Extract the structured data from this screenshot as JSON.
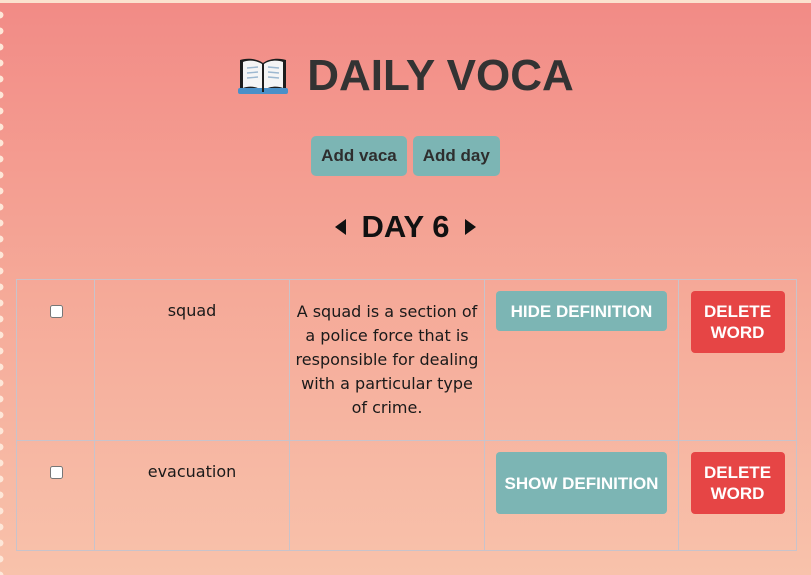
{
  "app": {
    "title": "DAILY VOCA"
  },
  "toolbar": {
    "add_voca_label": "Add vaca",
    "add_day_label": "Add day"
  },
  "day_nav": {
    "title": "DAY 6"
  },
  "words": [
    {
      "checked": false,
      "word": "squad",
      "definition": "A squad is a section of a police force that is responsible for dealing with a particular type of crime.",
      "toggle_label": "HIDE DEFINITION",
      "delete_label": "DELETE WORD"
    },
    {
      "checked": false,
      "word": "evacuation",
      "definition": "",
      "toggle_label": "SHOW DEFINITION",
      "delete_label": "DELETE WORD"
    }
  ],
  "icons": {
    "title_icon": "open-book-icon",
    "prev": "caret-left-icon",
    "next": "caret-right-icon"
  },
  "colors": {
    "accent_teal": "#7cb5b4",
    "danger_red": "#e64545",
    "text_dark": "#333333"
  }
}
